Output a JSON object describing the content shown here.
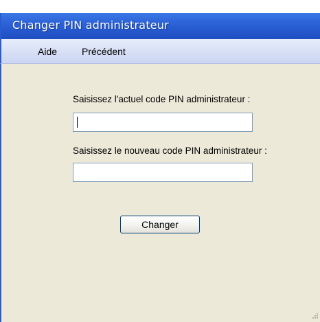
{
  "window": {
    "title": "Changer PIN administrateur"
  },
  "menu": {
    "items": [
      {
        "label": "Aide"
      },
      {
        "label": "Précédent"
      }
    ]
  },
  "form": {
    "current_pin_label": "Saisissez l'actuel code PIN administrateur :",
    "current_pin_value": "",
    "new_pin_label": "Saisissez le nouveau code PIN administrateur :",
    "new_pin_value": "",
    "submit_label": "Changer"
  },
  "colors": {
    "titlebar": "#2557cc",
    "menubar": "#d6def5",
    "content_background": "#ece9d8",
    "field_border": "#7f9db9",
    "button_border": "#003c74"
  },
  "icons": {
    "resize_grip": "size-grip-icon"
  }
}
